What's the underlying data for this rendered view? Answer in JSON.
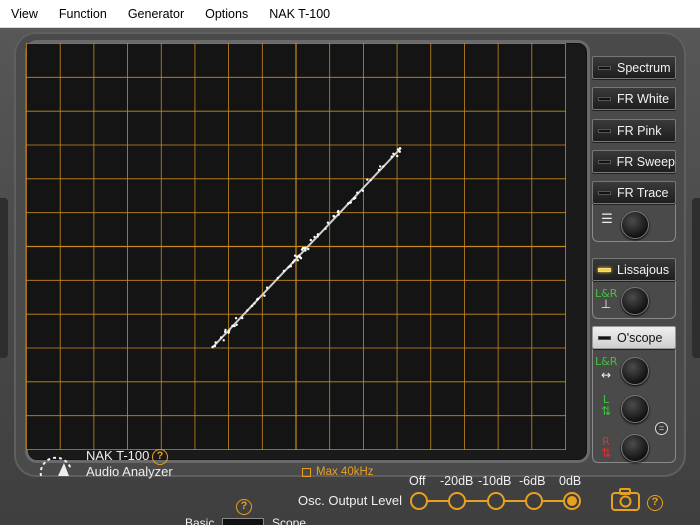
{
  "menu": [
    "View",
    "Function",
    "Generator",
    "Options",
    "NAK T-100"
  ],
  "modes": {
    "spectrum": "Spectrum",
    "fr_white": "FR White",
    "fr_pink": "FR Pink",
    "fr_sweep": "FR Sweep",
    "fr_trace": "FR Trace",
    "lissajous": "Lissajous",
    "oscope": "O'scope"
  },
  "knob_icons": {
    "lissajous_lr": "L&R",
    "oscope_lr": "L&R",
    "left": "L",
    "right": "R"
  },
  "brand": {
    "title": "NAK T-100",
    "subtitle": "Audio Analyzer"
  },
  "max_option": "Max 40kHz",
  "output_level": {
    "label": "Osc. Output Level",
    "options": [
      "Off",
      "-20dB",
      "-10dB",
      "-6dB",
      "0dB"
    ],
    "selected": "0dB"
  },
  "bottom": {
    "basic": "Basic",
    "scope": "Scope"
  },
  "help_glyph": "?",
  "colors": {
    "accent": "#e8a020",
    "grid": "#c88a1e",
    "screen_bg": "#141414",
    "trace": "#ffffff",
    "led_on": "#f2d14a"
  }
}
